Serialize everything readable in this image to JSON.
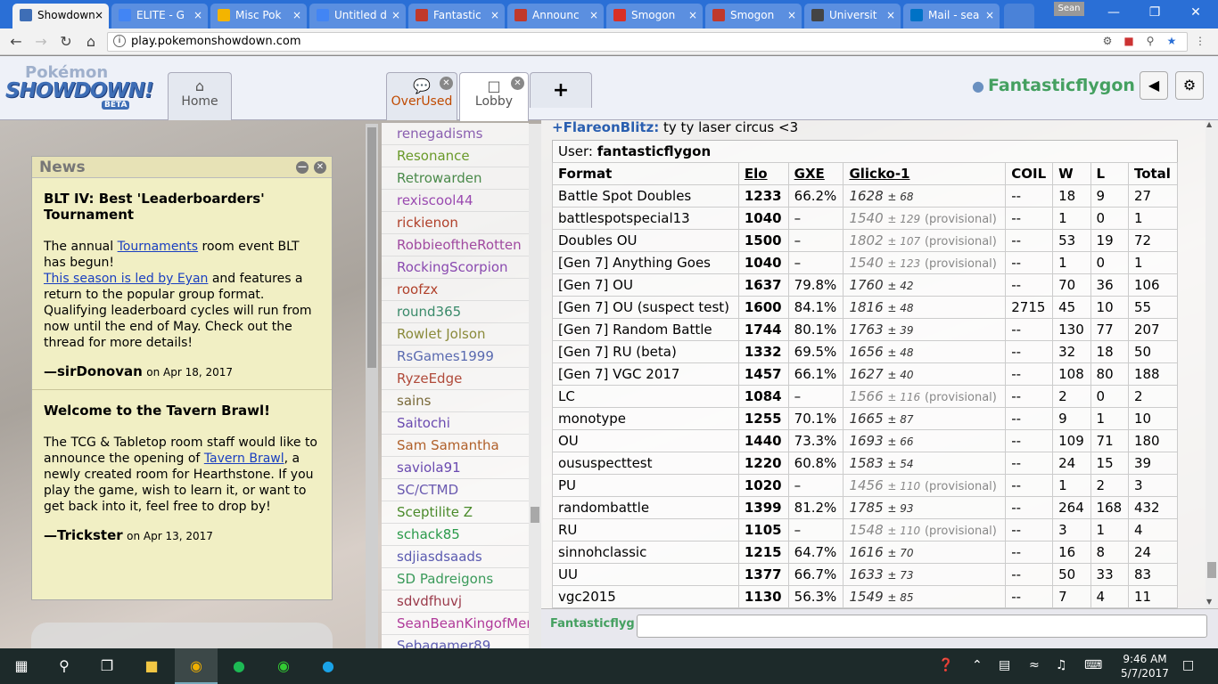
{
  "browser": {
    "tabs": [
      {
        "label": "Showdown",
        "icon": "showdown-favicon-icon",
        "active": true
      },
      {
        "label": "ELITE - G",
        "icon": "google-docs-icon"
      },
      {
        "label": "Misc Pok",
        "icon": "google-drive-icon"
      },
      {
        "label": "Untitled d",
        "icon": "google-docs-icon"
      },
      {
        "label": "Fantastic",
        "icon": "smogon-favicon-icon"
      },
      {
        "label": "Announc",
        "icon": "smogon-favicon-icon"
      },
      {
        "label": "Smogon",
        "icon": "gmail-icon"
      },
      {
        "label": "Smogon",
        "icon": "smogon-favicon-icon"
      },
      {
        "label": "Universit",
        "icon": "globe-icon"
      },
      {
        "label": "Mail - sea",
        "icon": "outlook-icon"
      }
    ],
    "user_badge": "Sean",
    "url": "play.pokemonshowdown.com"
  },
  "header": {
    "logo_line1": "Pokémon",
    "logo_line2": "SHOWDOWN!",
    "logo_beta": "BETA",
    "tabs": [
      {
        "label": "Home",
        "icon": "home-icon"
      },
      {
        "label": "OverUsed",
        "icon": "chat-bubbles-icon"
      },
      {
        "label": "Lobby",
        "icon": "chat-bubble-icon"
      }
    ],
    "new_tab": "+",
    "username": "Fantasticflygon"
  },
  "news": {
    "title": "News",
    "items": [
      {
        "title": "BLT IV: Best 'Leaderboarders' Tournament",
        "t1": "The annual ",
        "link1": "Tournaments",
        "t2": " room event BLT has begun!",
        "link2": "This season is led by Eyan",
        "t3": " and features a return to the popular group format. Qualifying leaderboard cycles will run from now until the end of May. Check out the thread for more details!",
        "author": "—sirDonovan",
        "date": "on Apr 18, 2017"
      },
      {
        "title": "Welcome to the Tavern Brawl!",
        "t1": "The TCG & Tabletop room staff would like to announce the opening of ",
        "link1": "Tavern Brawl",
        "t2": ", a newly created room for Hearthstone. If you play the game, wish to learn it, or want to get back into it, feel free to drop by!",
        "author": "—Trickster",
        "date": "on Apr 13, 2017"
      }
    ]
  },
  "userlist": [
    {
      "name": "renegadisms",
      "color": "#8a5fb0"
    },
    {
      "name": "Resonance",
      "color": "#6a9a2a"
    },
    {
      "name": "Retrowarden",
      "color": "#4a8a4a"
    },
    {
      "name": "rexiscool44",
      "color": "#9a4ab0"
    },
    {
      "name": "rickienon",
      "color": "#b0402a"
    },
    {
      "name": "RobbieoftheRotten",
      "color": "#a04aa0"
    },
    {
      "name": "RockingScorpion",
      "color": "#8a4ab0"
    },
    {
      "name": "roofzx",
      "color": "#b0402a"
    },
    {
      "name": "round365",
      "color": "#3a8a6a"
    },
    {
      "name": "Rowlet Jolson",
      "color": "#8a8a3a"
    },
    {
      "name": "RsGames1999",
      "color": "#5a6ab0"
    },
    {
      "name": "RyzeEdge",
      "color": "#b04a3a"
    },
    {
      "name": "sains",
      "color": "#7a6a3a"
    },
    {
      "name": "Saitochi",
      "color": "#6a4ab0"
    },
    {
      "name": "Sam Samantha",
      "color": "#b0602a"
    },
    {
      "name": "saviola91",
      "color": "#6a4ab0"
    },
    {
      "name": "SC/CTMD",
      "color": "#6a5ab0"
    },
    {
      "name": "Sceptilite Z",
      "color": "#4a8a2a"
    },
    {
      "name": "schack85",
      "color": "#2a9a4a"
    },
    {
      "name": "sdjiasdsaads",
      "color": "#5a5ab0"
    },
    {
      "name": "SD Padreigons",
      "color": "#3a9a5a"
    },
    {
      "name": "sdvdfhuvj",
      "color": "#9a3a4a"
    },
    {
      "name": "SeanBeanKingofMemes",
      "color": "#b03a9a"
    },
    {
      "name": "Sebagamer89",
      "color": "#5a5ab0"
    }
  ],
  "chat": {
    "line_name": "+FlareonBlitz:",
    "line_text": "ty ty laser circus <3",
    "ladder_user_label": "User:",
    "ladder_user": "fantasticflygon",
    "columns": [
      "Format",
      "Elo",
      "GXE",
      "Glicko-1",
      "COIL",
      "W",
      "L",
      "Total"
    ],
    "rows": [
      {
        "format": "Battle Spot Doubles",
        "elo": "1233",
        "gxe": "66.2%",
        "glicko": "1628",
        "dev": "± 68",
        "prov": "",
        "coil": "--",
        "w": "18",
        "l": "9",
        "total": "27"
      },
      {
        "format": "battlespotspecial13",
        "elo": "1040",
        "gxe": "–",
        "glicko": "1540",
        "dev": "± 129",
        "prov": "(provisional)",
        "coil": "--",
        "w": "1",
        "l": "0",
        "total": "1"
      },
      {
        "format": "Doubles OU",
        "elo": "1500",
        "gxe": "–",
        "glicko": "1802",
        "dev": "± 107",
        "prov": "(provisional)",
        "coil": "--",
        "w": "53",
        "l": "19",
        "total": "72"
      },
      {
        "format": "[Gen 7] Anything Goes",
        "elo": "1040",
        "gxe": "–",
        "glicko": "1540",
        "dev": "± 123",
        "prov": "(provisional)",
        "coil": "--",
        "w": "1",
        "l": "0",
        "total": "1"
      },
      {
        "format": "[Gen 7] OU",
        "elo": "1637",
        "gxe": "79.8%",
        "glicko": "1760",
        "dev": "± 42",
        "prov": "",
        "coil": "--",
        "w": "70",
        "l": "36",
        "total": "106"
      },
      {
        "format": "[Gen 7] OU (suspect test)",
        "elo": "1600",
        "gxe": "84.1%",
        "glicko": "1816",
        "dev": "± 48",
        "prov": "",
        "coil": "2715",
        "w": "45",
        "l": "10",
        "total": "55"
      },
      {
        "format": "[Gen 7] Random Battle",
        "elo": "1744",
        "gxe": "80.1%",
        "glicko": "1763",
        "dev": "± 39",
        "prov": "",
        "coil": "--",
        "w": "130",
        "l": "77",
        "total": "207"
      },
      {
        "format": "[Gen 7] RU (beta)",
        "elo": "1332",
        "gxe": "69.5%",
        "glicko": "1656",
        "dev": "± 48",
        "prov": "",
        "coil": "--",
        "w": "32",
        "l": "18",
        "total": "50"
      },
      {
        "format": "[Gen 7] VGC 2017",
        "elo": "1457",
        "gxe": "66.1%",
        "glicko": "1627",
        "dev": "± 40",
        "prov": "",
        "coil": "--",
        "w": "108",
        "l": "80",
        "total": "188"
      },
      {
        "format": "LC",
        "elo": "1084",
        "gxe": "–",
        "glicko": "1566",
        "dev": "± 116",
        "prov": "(provisional)",
        "coil": "--",
        "w": "2",
        "l": "0",
        "total": "2"
      },
      {
        "format": "monotype",
        "elo": "1255",
        "gxe": "70.1%",
        "glicko": "1665",
        "dev": "± 87",
        "prov": "",
        "coil": "--",
        "w": "9",
        "l": "1",
        "total": "10"
      },
      {
        "format": "OU",
        "elo": "1440",
        "gxe": "73.3%",
        "glicko": "1693",
        "dev": "± 66",
        "prov": "",
        "coil": "--",
        "w": "109",
        "l": "71",
        "total": "180"
      },
      {
        "format": "oususpecttest",
        "elo": "1220",
        "gxe": "60.8%",
        "glicko": "1583",
        "dev": "± 54",
        "prov": "",
        "coil": "--",
        "w": "24",
        "l": "15",
        "total": "39"
      },
      {
        "format": "PU",
        "elo": "1020",
        "gxe": "–",
        "glicko": "1456",
        "dev": "± 110",
        "prov": "(provisional)",
        "coil": "--",
        "w": "1",
        "l": "2",
        "total": "3"
      },
      {
        "format": "randombattle",
        "elo": "1399",
        "gxe": "81.2%",
        "glicko": "1785",
        "dev": "± 93",
        "prov": "",
        "coil": "--",
        "w": "264",
        "l": "168",
        "total": "432"
      },
      {
        "format": "RU",
        "elo": "1105",
        "gxe": "–",
        "glicko": "1548",
        "dev": "± 110",
        "prov": "(provisional)",
        "coil": "--",
        "w": "3",
        "l": "1",
        "total": "4"
      },
      {
        "format": "sinnohclassic",
        "elo": "1215",
        "gxe": "64.7%",
        "glicko": "1616",
        "dev": "± 70",
        "prov": "",
        "coil": "--",
        "w": "16",
        "l": "8",
        "total": "24"
      },
      {
        "format": "UU",
        "elo": "1377",
        "gxe": "66.7%",
        "glicko": "1633",
        "dev": "± 73",
        "prov": "",
        "coil": "--",
        "w": "50",
        "l": "33",
        "total": "83"
      },
      {
        "format": "vgc2015",
        "elo": "1130",
        "gxe": "56.3%",
        "glicko": "1549",
        "dev": "± 85",
        "prov": "",
        "coil": "--",
        "w": "7",
        "l": "4",
        "total": "11"
      }
    ],
    "input_name": "Fantasticflygon"
  },
  "taskbar": {
    "time": "9:46 AM",
    "date": "5/7/2017"
  }
}
